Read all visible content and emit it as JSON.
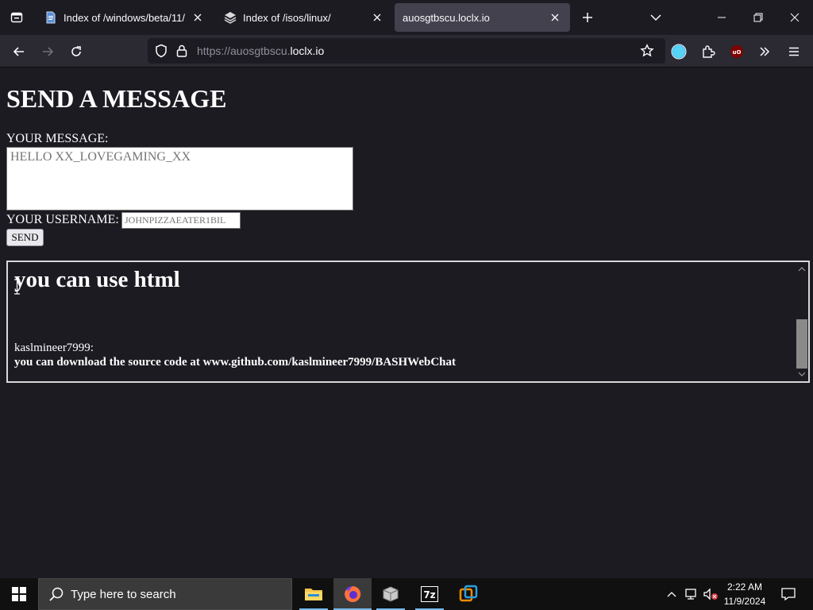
{
  "browser": {
    "tabs": [
      {
        "title": "Index of /windows/beta/11/",
        "icon": "document-icon",
        "active": false
      },
      {
        "title": "Index of /isos/linux/",
        "icon": "stack-icon",
        "active": false
      },
      {
        "title": "auosgtbscu.loclx.io",
        "icon": "",
        "active": true
      }
    ],
    "url_prefix": "https://auosgtbscu.",
    "url_host": "loclx.io",
    "accent": "#42414d"
  },
  "page": {
    "heading": "SEND A MESSAGE",
    "message_label": "YOUR MESSAGE:",
    "message_placeholder": "HELLO XX_LOVEGAMING_XX",
    "username_label": "YOUR USERNAME:",
    "username_placeholder": "JOHNPIZZAEATER1BIL",
    "send_label": "SEND"
  },
  "chat": {
    "big_text": "you can use html",
    "username": "kaslmineer7999:",
    "message": "you can download the source code at www.github.com/kaslmineer7999/BASHWebChat"
  },
  "taskbar": {
    "search_placeholder": "Type here to search",
    "time": "2:22 AM",
    "date": "11/9/2024",
    "apps": [
      "file-explorer-icon",
      "firefox-icon",
      "virtualbox-icon",
      "7zip-icon",
      "vmware-icon"
    ]
  }
}
